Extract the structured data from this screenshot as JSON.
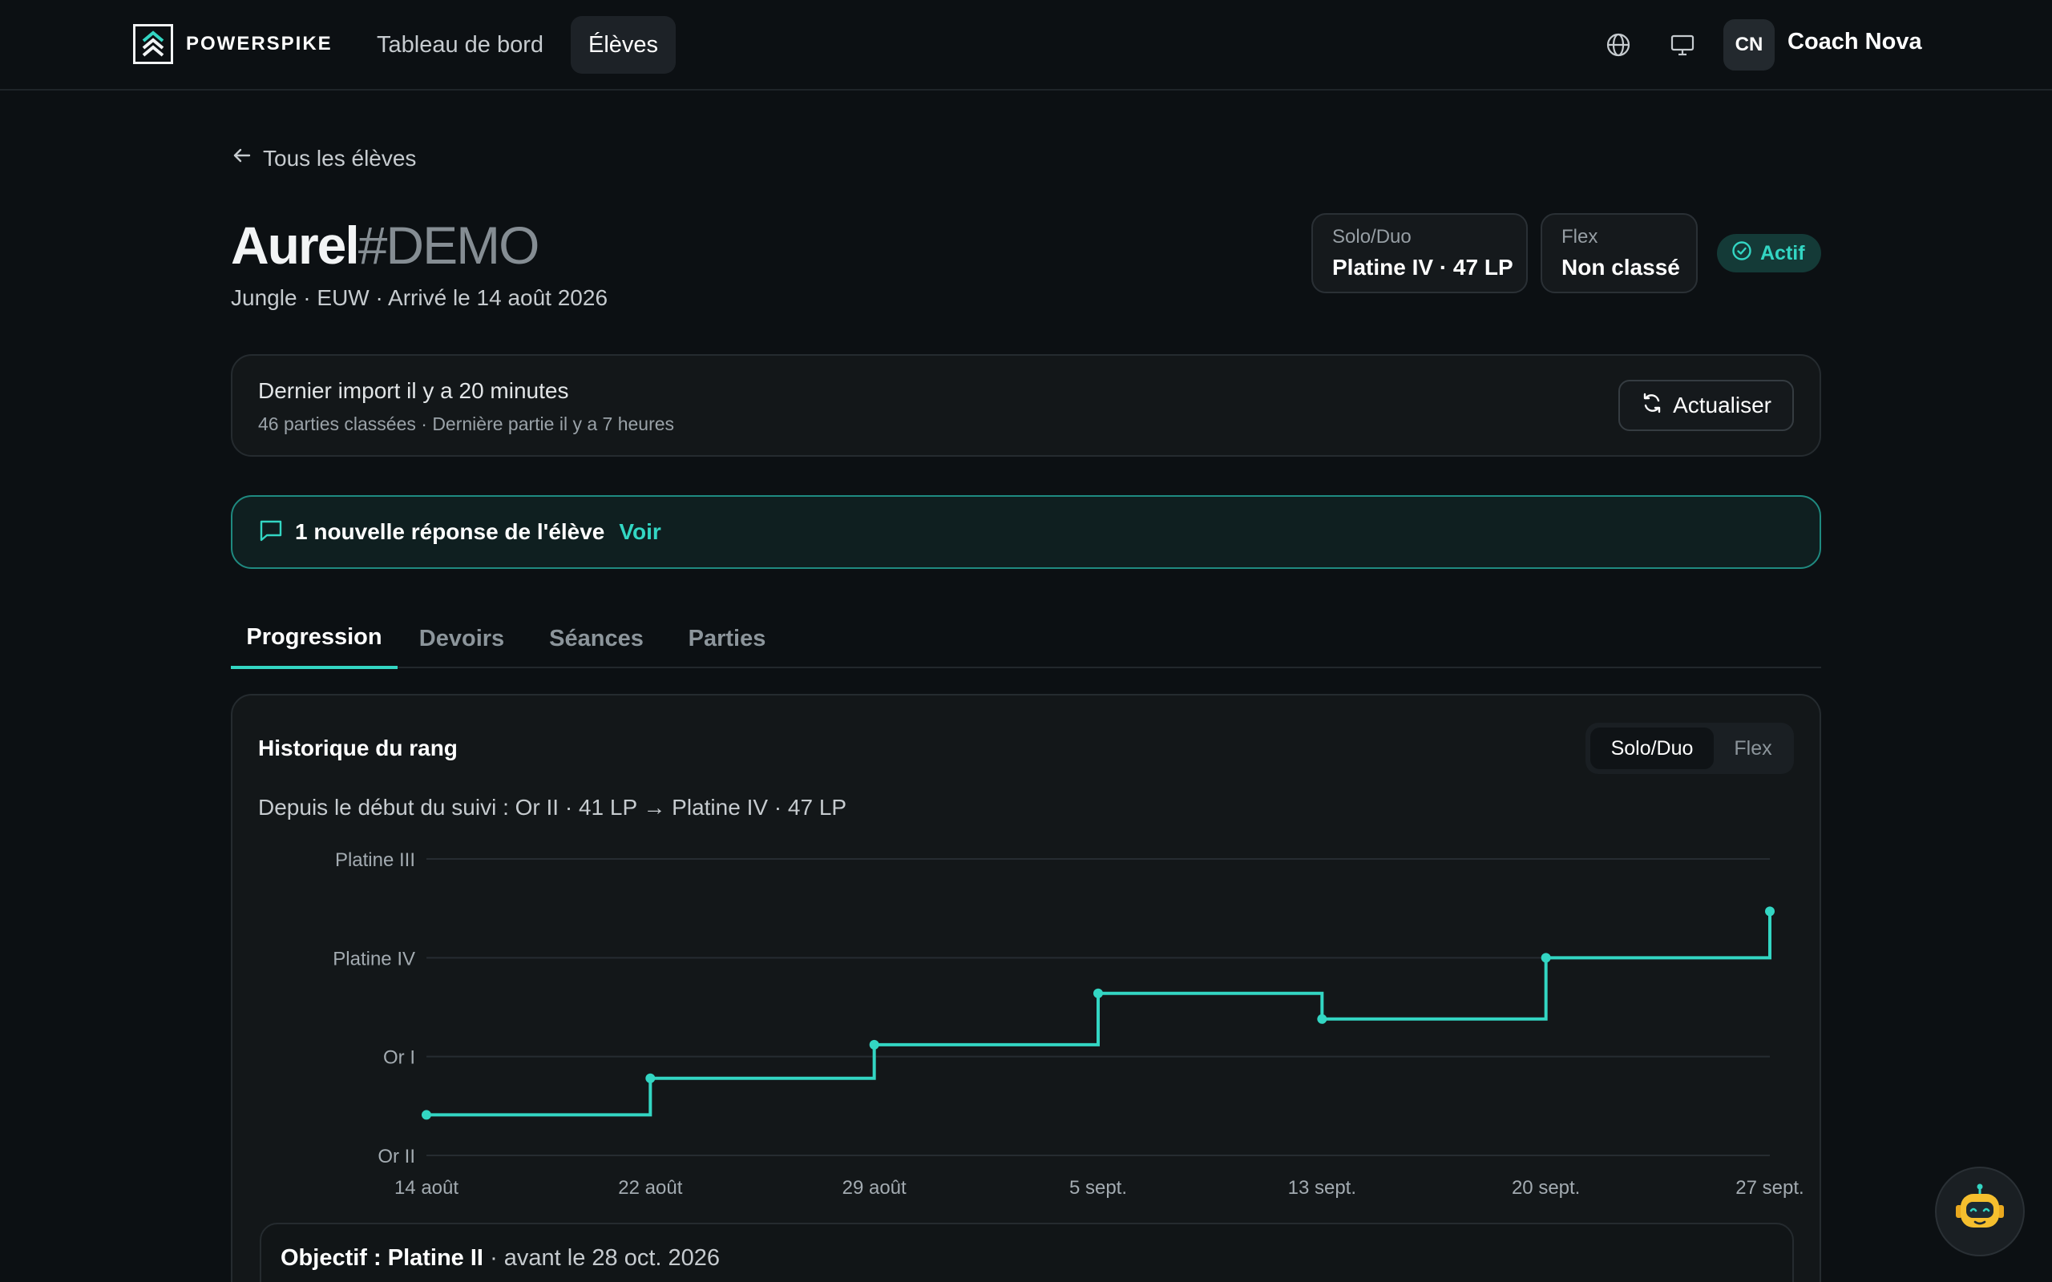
{
  "header": {
    "brand": "POWERSPIKE",
    "nav": [
      {
        "label": "Tableau de bord",
        "active": false
      },
      {
        "label": "Élèves",
        "active": true
      }
    ],
    "icons": [
      "globe-icon",
      "monitor-icon"
    ],
    "user": {
      "initials": "CN",
      "name": "Coach Nova"
    }
  },
  "back_link": "Tous les élèves",
  "student": {
    "name": "Aurel",
    "tag": "#DEMO",
    "meta": "Jungle · EUW · Arrivé le 14 août 2026",
    "ranks": [
      {
        "queue": "Solo/Duo",
        "value": "Platine IV · 47 LP"
      },
      {
        "queue": "Flex",
        "value": "Non classé"
      }
    ],
    "status": "Actif"
  },
  "import": {
    "title": "Dernier import il y a 20 minutes",
    "subtitle": "46 parties classées · Dernière partie il y a 7 heures",
    "refresh_label": "Actualiser"
  },
  "notice": {
    "text": "1 nouvelle réponse de l'élève",
    "link": "Voir"
  },
  "tabs": [
    "Progression",
    "Devoirs",
    "Séances",
    "Parties"
  ],
  "active_tab": "Progression",
  "chart_panel": {
    "title": "Historique du rang",
    "toggle": [
      "Solo/Duo",
      "Flex"
    ],
    "toggle_active": "Solo/Duo",
    "summary": "Depuis le début du suivi : Or II · 41 LP → Platine IV · 47 LP"
  },
  "colors": {
    "accent": "#33d6c3",
    "background": "#0c1013",
    "panel": "#131719"
  },
  "chart_data": {
    "type": "line",
    "step": true,
    "title": "Historique du rang",
    "y_tick_labels": [
      "Or II",
      "Or I",
      "Platine IV",
      "Platine III"
    ],
    "y_tick_values": [
      0,
      100,
      200,
      300
    ],
    "ylim": [
      0,
      300
    ],
    "x_tick_labels": [
      "14 août",
      "22 août",
      "29 août",
      "5 sept.",
      "13 sept.",
      "20 sept.",
      "27 sept."
    ],
    "x": [
      "14 août",
      "22 août",
      "29 août",
      "5 sept.",
      "13 sept.",
      "20 sept.",
      "27 sept."
    ],
    "series": [
      {
        "values": [
          41,
          78,
          112,
          164,
          138,
          200,
          247
        ]
      }
    ],
    "grid": true,
    "legend": "none"
  },
  "goal": {
    "label": "Objectif : Platine II",
    "deadline": "· avant le 28 oct. 2026"
  }
}
